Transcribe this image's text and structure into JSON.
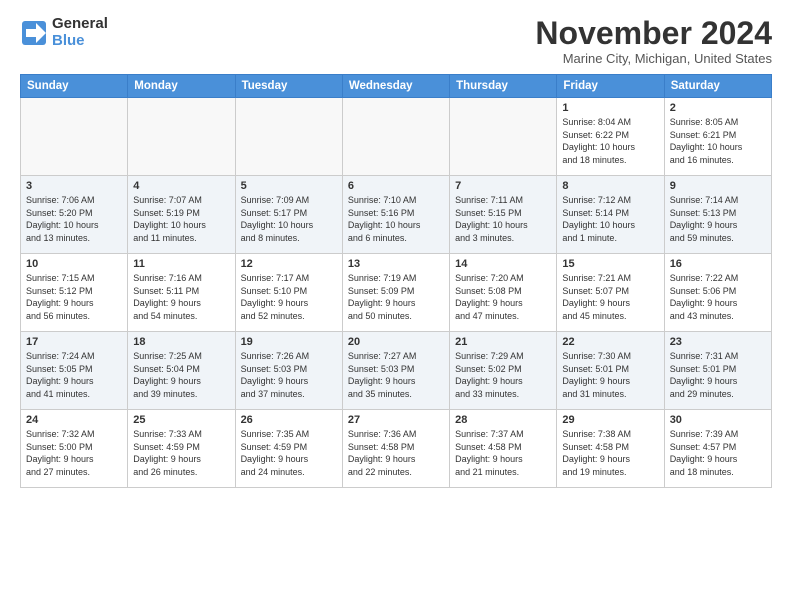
{
  "logo": {
    "general": "General",
    "blue": "Blue"
  },
  "title": "November 2024",
  "location": "Marine City, Michigan, United States",
  "days_header": [
    "Sunday",
    "Monday",
    "Tuesday",
    "Wednesday",
    "Thursday",
    "Friday",
    "Saturday"
  ],
  "weeks": [
    [
      {
        "num": "",
        "info": ""
      },
      {
        "num": "",
        "info": ""
      },
      {
        "num": "",
        "info": ""
      },
      {
        "num": "",
        "info": ""
      },
      {
        "num": "",
        "info": ""
      },
      {
        "num": "1",
        "info": "Sunrise: 8:04 AM\nSunset: 6:22 PM\nDaylight: 10 hours\nand 18 minutes."
      },
      {
        "num": "2",
        "info": "Sunrise: 8:05 AM\nSunset: 6:21 PM\nDaylight: 10 hours\nand 16 minutes."
      }
    ],
    [
      {
        "num": "3",
        "info": "Sunrise: 7:06 AM\nSunset: 5:20 PM\nDaylight: 10 hours\nand 13 minutes."
      },
      {
        "num": "4",
        "info": "Sunrise: 7:07 AM\nSunset: 5:19 PM\nDaylight: 10 hours\nand 11 minutes."
      },
      {
        "num": "5",
        "info": "Sunrise: 7:09 AM\nSunset: 5:17 PM\nDaylight: 10 hours\nand 8 minutes."
      },
      {
        "num": "6",
        "info": "Sunrise: 7:10 AM\nSunset: 5:16 PM\nDaylight: 10 hours\nand 6 minutes."
      },
      {
        "num": "7",
        "info": "Sunrise: 7:11 AM\nSunset: 5:15 PM\nDaylight: 10 hours\nand 3 minutes."
      },
      {
        "num": "8",
        "info": "Sunrise: 7:12 AM\nSunset: 5:14 PM\nDaylight: 10 hours\nand 1 minute."
      },
      {
        "num": "9",
        "info": "Sunrise: 7:14 AM\nSunset: 5:13 PM\nDaylight: 9 hours\nand 59 minutes."
      }
    ],
    [
      {
        "num": "10",
        "info": "Sunrise: 7:15 AM\nSunset: 5:12 PM\nDaylight: 9 hours\nand 56 minutes."
      },
      {
        "num": "11",
        "info": "Sunrise: 7:16 AM\nSunset: 5:11 PM\nDaylight: 9 hours\nand 54 minutes."
      },
      {
        "num": "12",
        "info": "Sunrise: 7:17 AM\nSunset: 5:10 PM\nDaylight: 9 hours\nand 52 minutes."
      },
      {
        "num": "13",
        "info": "Sunrise: 7:19 AM\nSunset: 5:09 PM\nDaylight: 9 hours\nand 50 minutes."
      },
      {
        "num": "14",
        "info": "Sunrise: 7:20 AM\nSunset: 5:08 PM\nDaylight: 9 hours\nand 47 minutes."
      },
      {
        "num": "15",
        "info": "Sunrise: 7:21 AM\nSunset: 5:07 PM\nDaylight: 9 hours\nand 45 minutes."
      },
      {
        "num": "16",
        "info": "Sunrise: 7:22 AM\nSunset: 5:06 PM\nDaylight: 9 hours\nand 43 minutes."
      }
    ],
    [
      {
        "num": "17",
        "info": "Sunrise: 7:24 AM\nSunset: 5:05 PM\nDaylight: 9 hours\nand 41 minutes."
      },
      {
        "num": "18",
        "info": "Sunrise: 7:25 AM\nSunset: 5:04 PM\nDaylight: 9 hours\nand 39 minutes."
      },
      {
        "num": "19",
        "info": "Sunrise: 7:26 AM\nSunset: 5:03 PM\nDaylight: 9 hours\nand 37 minutes."
      },
      {
        "num": "20",
        "info": "Sunrise: 7:27 AM\nSunset: 5:03 PM\nDaylight: 9 hours\nand 35 minutes."
      },
      {
        "num": "21",
        "info": "Sunrise: 7:29 AM\nSunset: 5:02 PM\nDaylight: 9 hours\nand 33 minutes."
      },
      {
        "num": "22",
        "info": "Sunrise: 7:30 AM\nSunset: 5:01 PM\nDaylight: 9 hours\nand 31 minutes."
      },
      {
        "num": "23",
        "info": "Sunrise: 7:31 AM\nSunset: 5:01 PM\nDaylight: 9 hours\nand 29 minutes."
      }
    ],
    [
      {
        "num": "24",
        "info": "Sunrise: 7:32 AM\nSunset: 5:00 PM\nDaylight: 9 hours\nand 27 minutes."
      },
      {
        "num": "25",
        "info": "Sunrise: 7:33 AM\nSunset: 4:59 PM\nDaylight: 9 hours\nand 26 minutes."
      },
      {
        "num": "26",
        "info": "Sunrise: 7:35 AM\nSunset: 4:59 PM\nDaylight: 9 hours\nand 24 minutes."
      },
      {
        "num": "27",
        "info": "Sunrise: 7:36 AM\nSunset: 4:58 PM\nDaylight: 9 hours\nand 22 minutes."
      },
      {
        "num": "28",
        "info": "Sunrise: 7:37 AM\nSunset: 4:58 PM\nDaylight: 9 hours\nand 21 minutes."
      },
      {
        "num": "29",
        "info": "Sunrise: 7:38 AM\nSunset: 4:58 PM\nDaylight: 9 hours\nand 19 minutes."
      },
      {
        "num": "30",
        "info": "Sunrise: 7:39 AM\nSunset: 4:57 PM\nDaylight: 9 hours\nand 18 minutes."
      }
    ]
  ]
}
